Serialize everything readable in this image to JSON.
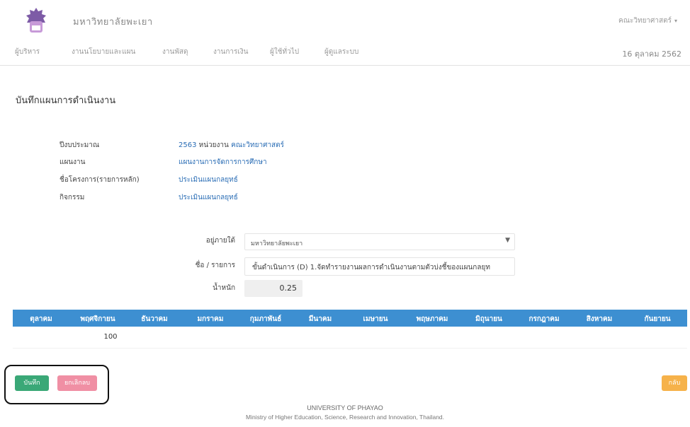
{
  "header": {
    "brand": "มหาวิทยาลัยพะเยา",
    "faculty_menu": "คณะวิทยาศาสตร์"
  },
  "menu": {
    "items": [
      "ผู้บริหาร",
      "งานนโยบายและแผน",
      "งานพัสดุ",
      "งานการเงิน",
      "ผู้ใช้ทั่วไป",
      "ผู้ดูแลระบบ"
    ]
  },
  "date": "16 ตุลาคม 2562",
  "page": {
    "title": "บันทึกแผนการดำเนินงาน"
  },
  "info": {
    "year_label": "ปีงบประมาณ",
    "year_value": "2563",
    "unit_label": "หน่วยงาน",
    "unit_value": "คณะวิทยาศาสตร์",
    "plan_label": "แผนงาน",
    "plan_value": "แผนงานการจัดการการศึกษา",
    "project_label": "ชื่อโครงการ(รายการหลัก)",
    "project_value": "ประเมินแผนกลยุทธ์",
    "activity_label": "กิจกรรม",
    "activity_value": "ประเมินแผนกลยุทธ์"
  },
  "form": {
    "under_label": "อยู่ภายใต้",
    "under_value": "มหาวิทยาลัยพะเยา",
    "item_label": "ชื่อ / รายการ",
    "item_value": "ขั้นดำเนินการ (D) 1.จัดทำรายงานผลการดำเนินงานตามตัวบ่งชี้ของแผนกลยุท",
    "weight_label": "น้ำหนัก",
    "weight_value": "0.25"
  },
  "months": {
    "headers": [
      "ตุลาคม",
      "พฤศจิกายน",
      "ธันวาคม",
      "มกราคม",
      "กุมภาพันธ์",
      "มีนาคม",
      "เมษายน",
      "พฤษภาคม",
      "มิถุนายน",
      "กรกฎาคม",
      "สิงหาคม",
      "กันยายน"
    ],
    "values": [
      "",
      "100",
      "",
      "",
      "",
      "",
      "",
      "",
      "",
      "",
      "",
      ""
    ]
  },
  "buttons": {
    "save": "บันทึก",
    "cancel": "ยกเลิกลบ",
    "back": "กลับ"
  },
  "footer": {
    "line1": "UNIVERSITY OF PHAYAO",
    "line2": "Ministry of Higher Education, Science, Research and Innovation, Thailand."
  },
  "colors": {
    "primary": "#3d8fd1",
    "success": "#3aa877",
    "danger": "#f08fa4",
    "warning": "#f6b24a"
  }
}
